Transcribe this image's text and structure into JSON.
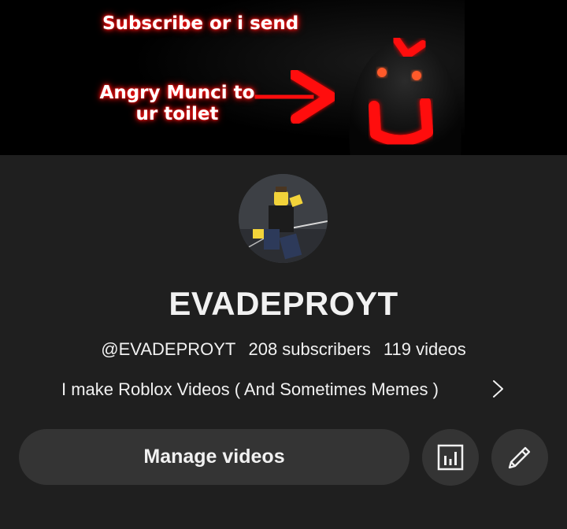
{
  "banner": {
    "line1": "Subscribe or i send",
    "line2": "Angry Munci to ur toilet"
  },
  "channel": {
    "name": "EVADEPROYT",
    "handle": "@EVADEPROYT",
    "subscribers": "208 subscribers",
    "videos": "119 videos",
    "description": "I make Roblox Videos ( And Sometimes Memes )"
  },
  "actions": {
    "manage_label": "Manage videos",
    "analytics_icon": "analytics-icon",
    "edit_icon": "pencil-icon"
  },
  "colors": {
    "background": "#0f0f0f",
    "surface": "#1f1f1f",
    "button": "#343434",
    "banner_glow": "#ff0000"
  }
}
